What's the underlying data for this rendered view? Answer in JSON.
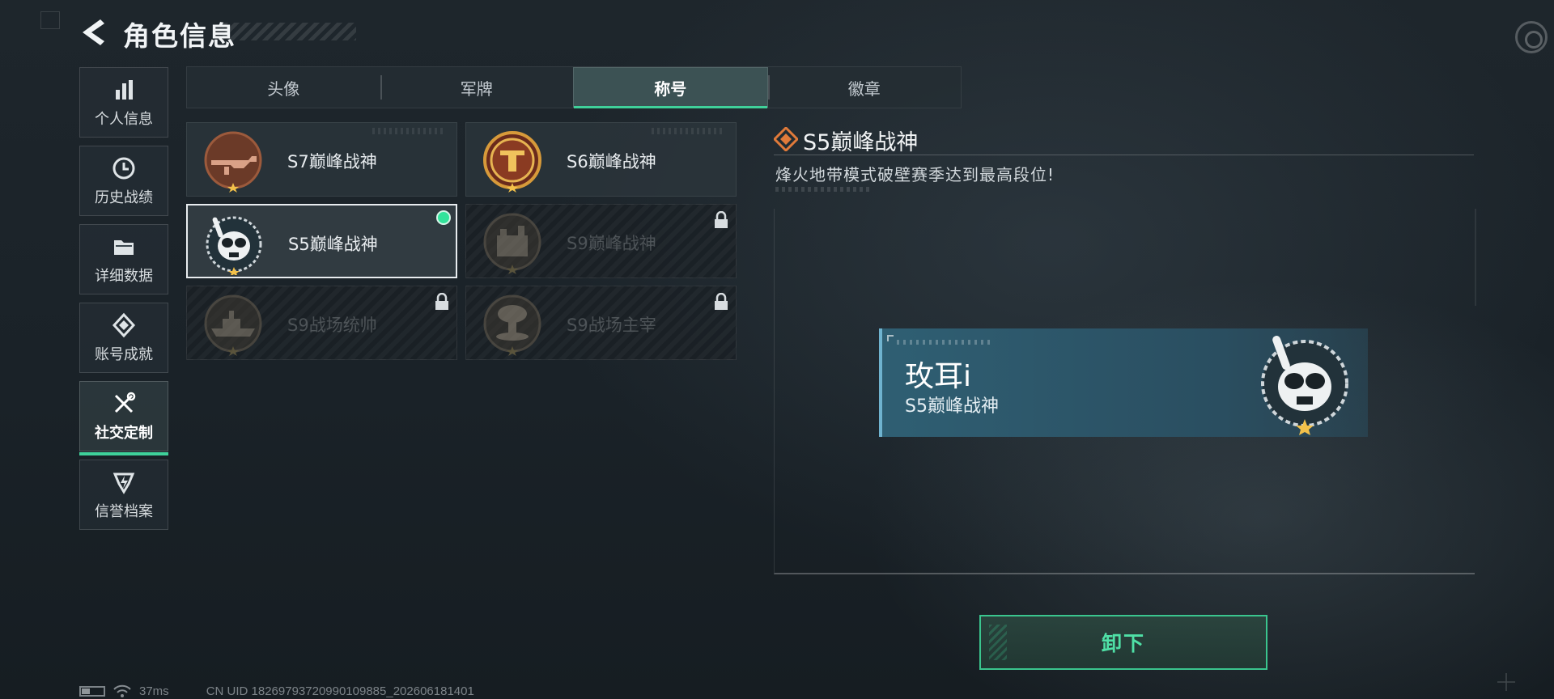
{
  "header": {
    "title": "角色信息",
    "back_icon": "back-arrow-icon",
    "settings_icon": "settings-icon"
  },
  "sidebar": {
    "items": [
      {
        "label": "个人信息",
        "icon": "bar-chart-icon",
        "active": false
      },
      {
        "label": "历史战绩",
        "icon": "clock-icon",
        "active": false
      },
      {
        "label": "详细数据",
        "icon": "folder-icon",
        "active": false
      },
      {
        "label": "账号成就",
        "icon": "achievement-icon",
        "active": false
      },
      {
        "label": "社交定制",
        "icon": "tools-icon",
        "active": true
      },
      {
        "label": "信誉档案",
        "icon": "credibility-icon",
        "active": false
      }
    ]
  },
  "tabs": [
    {
      "label": "头像",
      "active": false
    },
    {
      "label": "军牌",
      "active": false
    },
    {
      "label": "称号",
      "active": true
    },
    {
      "label": "徽章",
      "active": false
    }
  ],
  "titles": [
    {
      "name": "S7巅峰战神",
      "state": "owned",
      "emblem": "rifle-emblem-icon"
    },
    {
      "name": "S6巅峰战神",
      "state": "owned",
      "emblem": "crest-emblem-icon"
    },
    {
      "name": "S5巅峰战神",
      "state": "equipped",
      "emblem": "skull-mask-emblem-icon"
    },
    {
      "name": "S9巅峰战神",
      "state": "locked",
      "emblem": "fortress-emblem-icon"
    },
    {
      "name": "S9战场统帅",
      "state": "locked",
      "emblem": "warship-emblem-icon"
    },
    {
      "name": "S9战场主宰",
      "state": "locked",
      "emblem": "mushroom-cloud-emblem-icon"
    }
  ],
  "detail": {
    "title": "S5巅峰战神",
    "description": "烽火地带模式破壁赛季达到最高段位!",
    "preview": {
      "player_name": "玫耳i",
      "title": "S5巅峰战神"
    },
    "action_label": "卸下"
  },
  "status": {
    "ping": "37ms",
    "uid": "CN UID 18269793720990109885_202606181401"
  },
  "colors": {
    "accent": "#3fd19a",
    "equipped": "#33e39b",
    "detail_icon": "#e07a3a"
  }
}
